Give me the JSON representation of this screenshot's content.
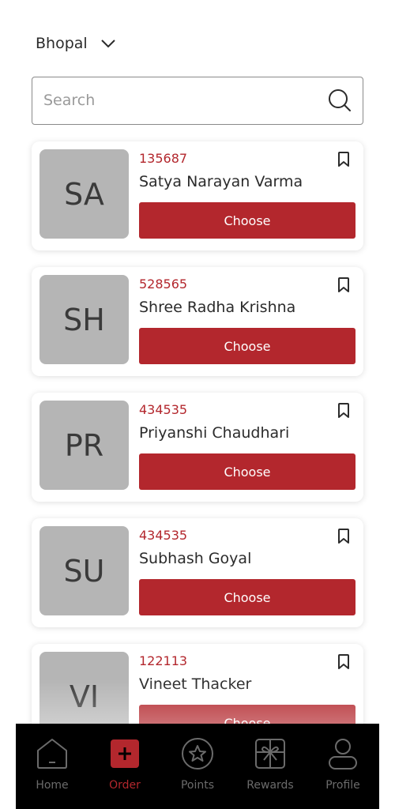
{
  "header": {
    "location": "Bhopal"
  },
  "search": {
    "placeholder": "Search"
  },
  "customers": [
    {
      "initials": "SA",
      "code": "135687",
      "name": "Satya Narayan Varma",
      "action": "Choose"
    },
    {
      "initials": "SH",
      "code": "528565",
      "name": "Shree Radha Krishna",
      "action": "Choose"
    },
    {
      "initials": "PR",
      "code": "434535",
      "name": "Priyanshi Chaudhari",
      "action": "Choose"
    },
    {
      "initials": "SU",
      "code": "434535",
      "name": "Subhash Goyal",
      "action": "Choose"
    },
    {
      "initials": "VI",
      "code": "122113",
      "name": "Vineet Thacker",
      "action": "Choose"
    }
  ],
  "nav": {
    "items": [
      {
        "label": "Home",
        "icon": "home-icon"
      },
      {
        "label": "Order",
        "icon": "order-plus-icon",
        "active": true
      },
      {
        "label": "Points",
        "icon": "star-badge-icon"
      },
      {
        "label": "Rewards",
        "icon": "gift-icon"
      },
      {
        "label": "Profile",
        "icon": "user-icon"
      }
    ]
  },
  "colors": {
    "accent": "#b3272d",
    "avatar_bg": "#b5b5b5",
    "nav_bg": "#000000",
    "nav_inactive": "#6b6b6b"
  }
}
